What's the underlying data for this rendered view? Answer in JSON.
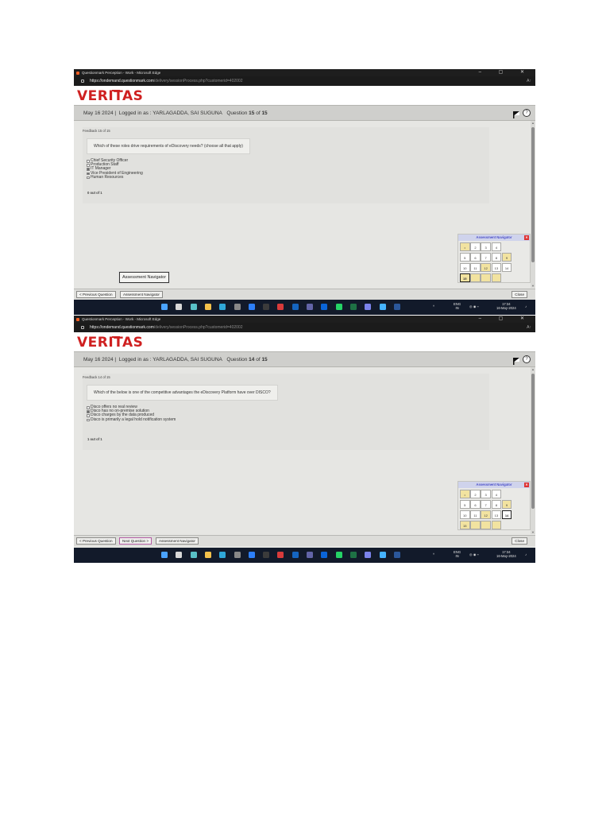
{
  "screens": [
    {
      "window_title": "Questionmark Perception - Work - Microsoft Edge",
      "window_controls": "–  ▢  ✕",
      "url_host": "https://ondemand.questionmark.com",
      "url_rest": "/delivery/sessionProcess.php?customerid=402002",
      "logo": "VERITAS",
      "date": "May 16 2024 |",
      "logged_in": "Logged in as : YARLAGADDA, SAI SUGUNA",
      "question_word": "Question",
      "question_num": "15",
      "of_word": "of",
      "question_total": "15",
      "feedback_label": "Feedback 15 of 15",
      "question_text": "Which of these roles drive requirements of eDiscovery needs? (choose all that apply)",
      "options": [
        {
          "label": "Chief Security Officer",
          "checked": false
        },
        {
          "label": "Production Staff",
          "checked": false
        },
        {
          "label": "IT Manager",
          "checked": true
        },
        {
          "label": "Vice President of Engineering",
          "checked": true
        },
        {
          "label": "Human Resources",
          "checked": false
        }
      ],
      "score": "0 out of 1",
      "navigator": {
        "title": "Assessment Navigator",
        "close": "✕",
        "cells": [
          {
            "label": "•",
            "state": "visited"
          },
          {
            "label": "2",
            "state": ""
          },
          {
            "label": "3",
            "state": ""
          },
          {
            "label": "4",
            "state": ""
          },
          {
            "label": "5",
            "state": ""
          },
          {
            "label": "6",
            "state": ""
          },
          {
            "label": "7",
            "state": ""
          },
          {
            "label": "8",
            "state": ""
          },
          {
            "label": "9",
            "state": "visited"
          },
          {
            "label": "10",
            "state": ""
          },
          {
            "label": "11",
            "state": ""
          },
          {
            "label": "12",
            "state": "visited"
          },
          {
            "label": "13",
            "state": ""
          },
          {
            "label": "14",
            "state": ""
          },
          {
            "label": "15",
            "state": "current visited"
          },
          {
            "label": "",
            "state": "visited"
          },
          {
            "label": "",
            "state": "visited"
          },
          {
            "label": "",
            "state": "visited"
          }
        ]
      },
      "tooltip": "Assessment Navigator",
      "buttons": {
        "prev": "< Previous Question",
        "next": "",
        "navigator": "Assessment Navigator",
        "close": "Close"
      },
      "tray": {
        "lang": "ENG",
        "region": "IN",
        "time": "17:34",
        "date": "16-May-2024"
      }
    },
    {
      "window_title": "Questionmark Perception - Work - Microsoft Edge",
      "window_controls": "–  ▢  ✕",
      "url_host": "https://ondemand.questionmark.com",
      "url_rest": "/delivery/sessionProcess.php?customerid=402002",
      "logo": "VERITAS",
      "date": "May 16 2024 |",
      "logged_in": "Logged in as : YARLAGADDA, SAI SUGUNA",
      "question_word": "Question",
      "question_num": "14",
      "of_word": "of",
      "question_total": "15",
      "feedback_label": "Feedback 14 of 15",
      "question_text": "Which of the below is one of the competitive advantages the eDiscovery Platform have over DISCO?",
      "options": [
        {
          "label": "Disco offers no real review",
          "checked": false
        },
        {
          "label": "Disco has no on-premise solution",
          "checked": true
        },
        {
          "label": "Disco charges by the data produced",
          "checked": false
        },
        {
          "label": "Disco is primarily a legal hold notification system",
          "checked": false
        }
      ],
      "score": "1 out of 1",
      "navigator": {
        "title": "Assessment Navigator",
        "close": "✕",
        "cells": [
          {
            "label": "•",
            "state": "visited"
          },
          {
            "label": "2",
            "state": ""
          },
          {
            "label": "3",
            "state": ""
          },
          {
            "label": "4",
            "state": ""
          },
          {
            "label": "5",
            "state": ""
          },
          {
            "label": "6",
            "state": ""
          },
          {
            "label": "7",
            "state": ""
          },
          {
            "label": "8",
            "state": ""
          },
          {
            "label": "9",
            "state": "visited"
          },
          {
            "label": "10",
            "state": ""
          },
          {
            "label": "11",
            "state": ""
          },
          {
            "label": "12",
            "state": "visited"
          },
          {
            "label": "13",
            "state": ""
          },
          {
            "label": "14",
            "state": "current"
          },
          {
            "label": "15",
            "state": "visited"
          },
          {
            "label": "",
            "state": "visited"
          },
          {
            "label": "",
            "state": "visited"
          },
          {
            "label": "",
            "state": "visited"
          }
        ]
      },
      "tooltip": "",
      "buttons": {
        "prev": "< Previous Question",
        "next": "Next Question >",
        "navigator": "Assessment Navigator",
        "close": "Close"
      },
      "tray": {
        "lang": "ENG",
        "region": "IN",
        "time": "17:34",
        "date": "16-May-2024"
      }
    }
  ],
  "taskbar_icons": [
    {
      "name": "windows-start-icon",
      "color": "#4aa3ff"
    },
    {
      "name": "search-icon",
      "color": "#d8d8d8"
    },
    {
      "name": "copilot-icon",
      "color": "#58c0c7"
    },
    {
      "name": "file-explorer-icon",
      "color": "#f3c14b"
    },
    {
      "name": "edge-icon",
      "color": "#2fa7d8"
    },
    {
      "name": "widgets-icon",
      "color": "#888888"
    },
    {
      "name": "mail-icon",
      "color": "#2d7ff9"
    },
    {
      "name": "terminal-icon",
      "color": "#3b3b3b"
    },
    {
      "name": "app-red-icon",
      "color": "#d83b3b"
    },
    {
      "name": "outlook-icon",
      "color": "#1565c0"
    },
    {
      "name": "teams-icon",
      "color": "#6264a7"
    },
    {
      "name": "outlook-icon-2",
      "color": "#0a64d8"
    },
    {
      "name": "whatsapp-icon",
      "color": "#25d366"
    },
    {
      "name": "excel-icon",
      "color": "#1e7145"
    },
    {
      "name": "teams-icon-2",
      "color": "#7b83eb"
    },
    {
      "name": "phone-icon",
      "color": "#45b3ff"
    },
    {
      "name": "word-icon",
      "color": "#2b579a"
    }
  ]
}
